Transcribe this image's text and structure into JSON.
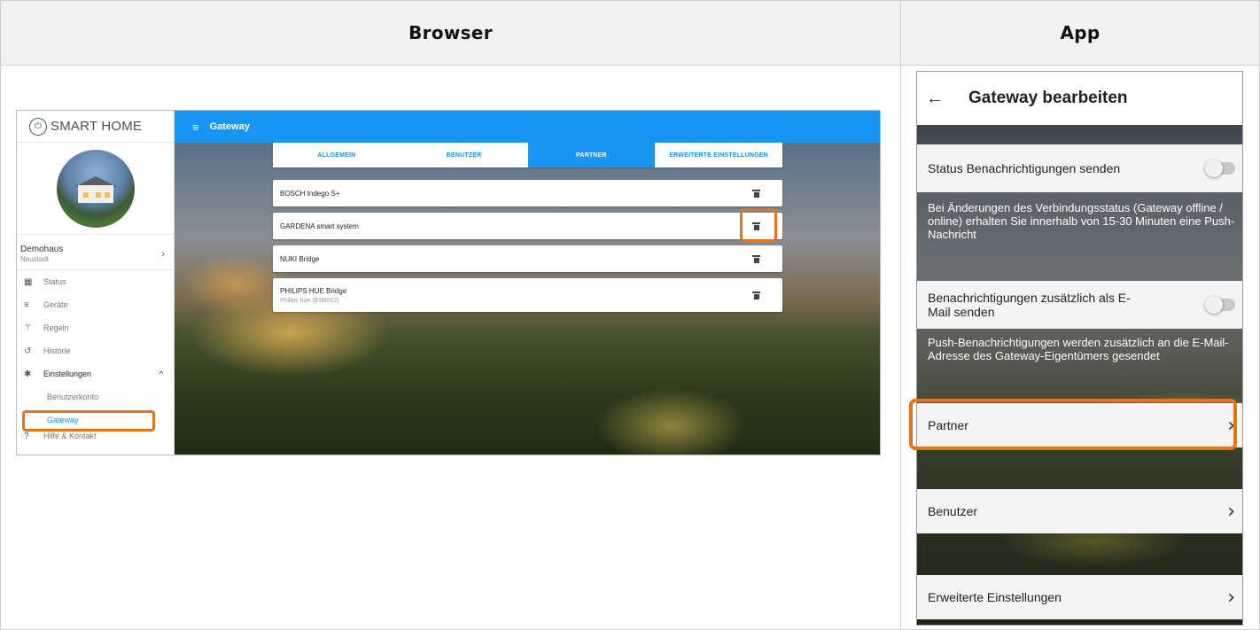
{
  "headers": {
    "browser": "Browser",
    "app": "App"
  },
  "browser": {
    "logo": "SMART HOME",
    "topbar_title": "Gateway",
    "home": {
      "name": "Demohaus",
      "location": "Neustadt"
    },
    "nav": [
      "Status",
      "Geräte",
      "Regeln",
      "Historie",
      "Einstellungen"
    ],
    "nav_sub": [
      "Benutzerkonto",
      "Gateway"
    ],
    "nav_more": "Hilfe & Kontakt",
    "tabs": [
      "ALLGEMEIN",
      "BENUTZER",
      "PARTNER",
      "ERWEITERTE EINSTELLUNGEN"
    ],
    "active_tab": "PARTNER",
    "partners": [
      {
        "name": "BOSCH Indego S+",
        "sub": ""
      },
      {
        "name": "GARDENA smart system",
        "sub": ""
      },
      {
        "name": "NUKI Bridge",
        "sub": ""
      },
      {
        "name": "PHILIPS HUE Bridge",
        "sub": "Philips hue (BSB002)"
      }
    ]
  },
  "app": {
    "title": "Gateway bearbeiten",
    "status_label": "Status Benachrichtigungen senden",
    "status_desc": "Bei Änderungen des Verbindungsstatus (Gateway offline / online) erhalten Sie innerhalb von 15-30 Minuten eine Push-Nachricht",
    "email_label": "Benachrichtigungen zusätzlich als E-Mail senden",
    "email_desc": "Push-Benachrichtigungen werden zusätzlich an die E-Mail-Adresse des Gateway-Eigentümers gesendet",
    "menu": [
      "Partner",
      "Benutzer",
      "Erweiterte Einstellungen"
    ]
  },
  "colors": {
    "highlight": "#e8731c",
    "primary": "#1a96f2"
  }
}
